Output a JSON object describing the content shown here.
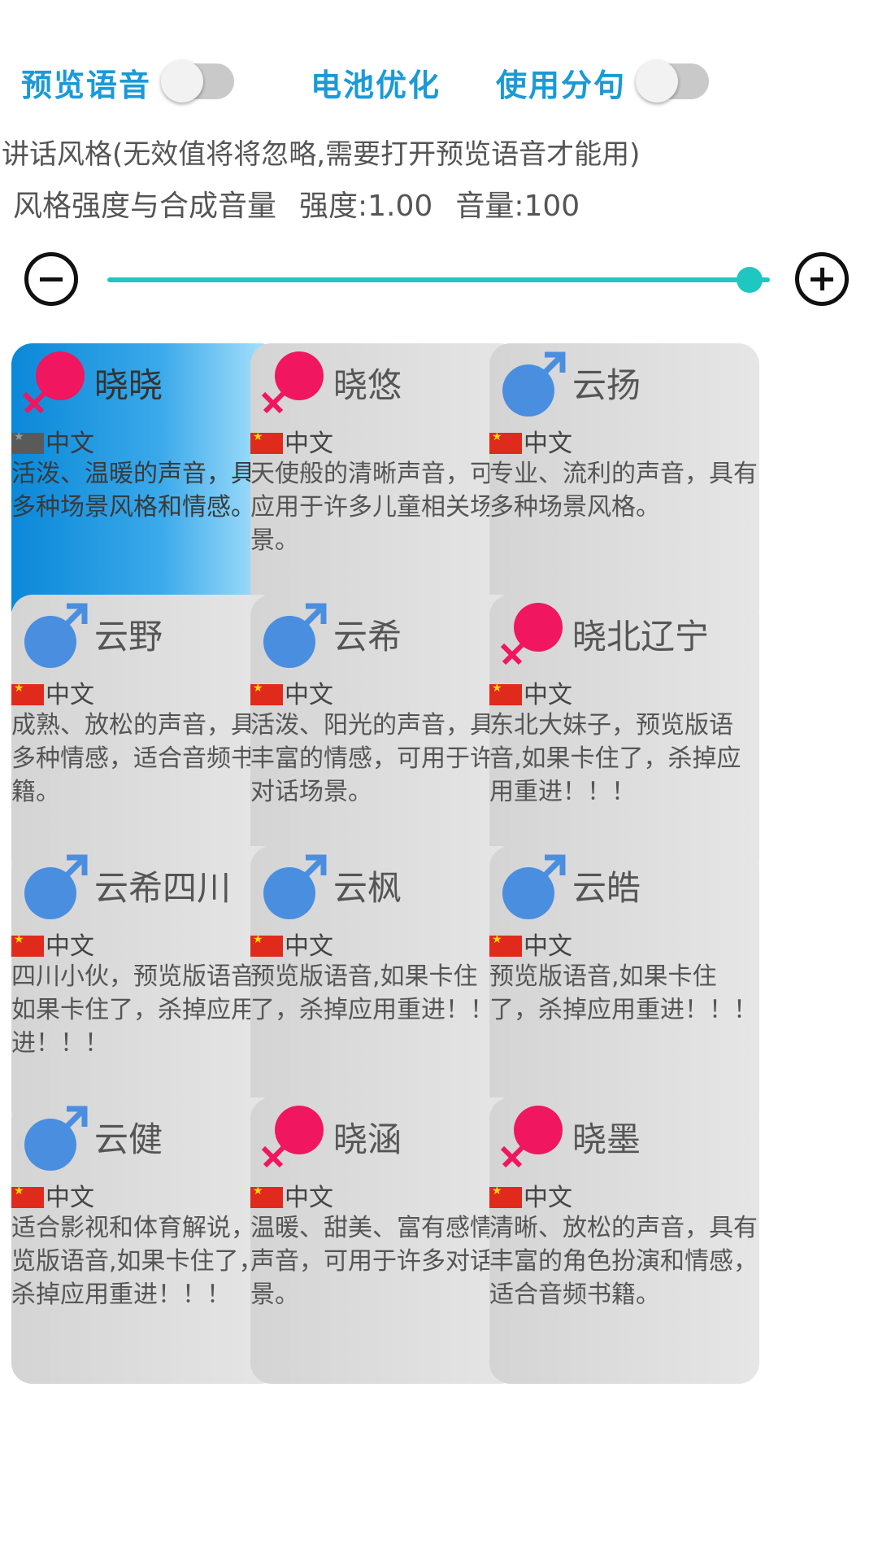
{
  "top": {
    "preview_voice_label": "预览语音",
    "battery_label": "电池优化",
    "sentence_split_label": "使用分句",
    "preview_voice_on": false,
    "sentence_split_on": false
  },
  "style_label": "讲话风格(无效值将将忽略,需要打开预览语音才能用)",
  "strength": {
    "label": "风格强度与合成音量",
    "strength_text": "强度:1.00",
    "volume_text": "音量:100",
    "slider_value": 0.95
  },
  "colors": {
    "accent": "#1a9ad6",
    "slider": "#1fc7c0",
    "female": "#f0165f",
    "male": "#4a8ee0",
    "selected": "#0a88d8"
  },
  "voices": [
    {
      "name": "晓晓",
      "gender": "female",
      "lang": "中文",
      "desc": "活泼、温暖的声音，具有多种场景风格和情感。",
      "selected": true
    },
    {
      "name": "晓悠",
      "gender": "female",
      "lang": "中文",
      "desc": "天使般的清晰声音，可以应用于许多儿童相关场景。",
      "selected": false
    },
    {
      "name": "云扬",
      "gender": "male",
      "lang": "中文",
      "desc": "专业、流利的声音，具有多种场景风格。",
      "selected": false
    },
    {
      "name": "云野",
      "gender": "male",
      "lang": "中文",
      "desc": "成熟、放松的声音，具有多种情感，适合音频书籍。",
      "selected": false
    },
    {
      "name": "云希",
      "gender": "male",
      "lang": "中文",
      "desc": "活泼、阳光的声音，具有丰富的情感，可用于许多对话场景。",
      "selected": false
    },
    {
      "name": "晓北辽宁",
      "gender": "female",
      "lang": "中文",
      "desc": "东北大妹子，预览版语音,如果卡住了，杀掉应用重进！！！",
      "selected": false
    },
    {
      "name": "云希四川",
      "gender": "male",
      "lang": "中文",
      "desc": "四川小伙，预览版语音,如果卡住了，杀掉应用重进！！！",
      "selected": false
    },
    {
      "name": "云枫",
      "gender": "male",
      "lang": "中文",
      "desc": "预览版语音,如果卡住了，杀掉应用重进！！！",
      "selected": false
    },
    {
      "name": "云皓",
      "gender": "male",
      "lang": "中文",
      "desc": "预览版语音,如果卡住了，杀掉应用重进！！！",
      "selected": false
    },
    {
      "name": "云健",
      "gender": "male",
      "lang": "中文",
      "desc": "适合影视和体育解说，预览版语音,如果卡住了，杀掉应用重进！！！",
      "selected": false
    },
    {
      "name": "晓涵",
      "gender": "female",
      "lang": "中文",
      "desc": "温暖、甜美、富有感情的声音，可用于许多对话场景。",
      "selected": false
    },
    {
      "name": "晓墨",
      "gender": "female",
      "lang": "中文",
      "desc": "清晰、放松的声音，具有丰富的角色扮演和情感，适合音频书籍。",
      "selected": false
    }
  ]
}
